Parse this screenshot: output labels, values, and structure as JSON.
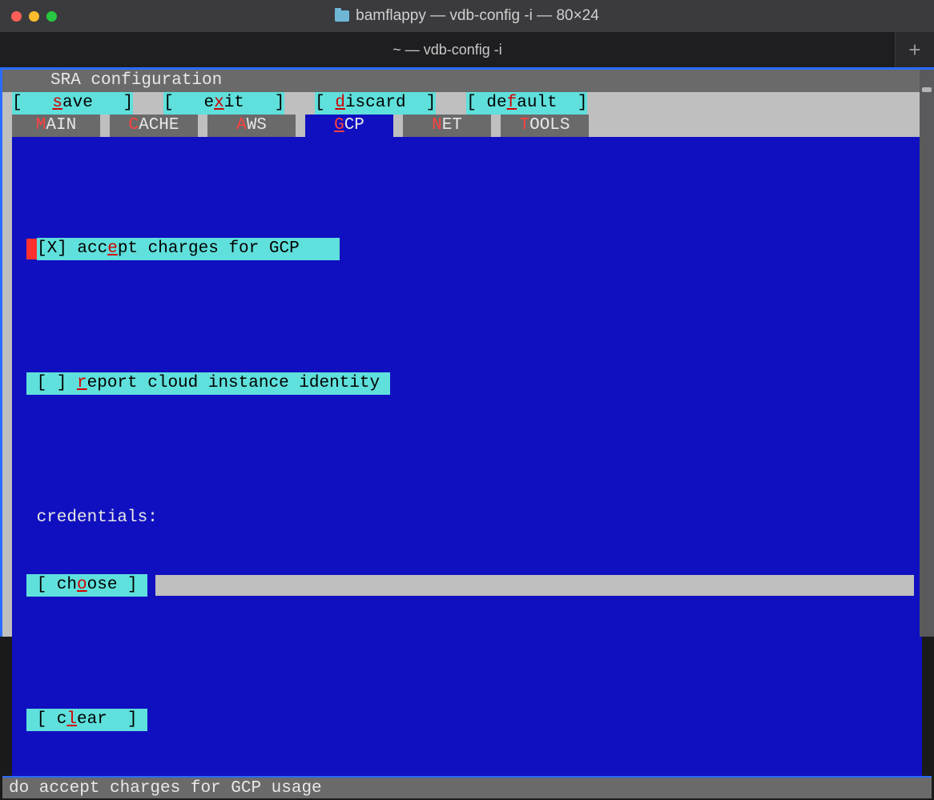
{
  "window": {
    "title": "bamflappy — vdb-config -i — 80×24",
    "tab_title": "~ — vdb-config -i"
  },
  "header": "SRA configuration",
  "buttons": {
    "save": {
      "pre": "[   ",
      "hk": "s",
      "rest": "ave   ]"
    },
    "exit": {
      "pre": "[   e",
      "hk": "x",
      "rest": "it   ]"
    },
    "discard": {
      "pre": "[ ",
      "hk": "d",
      "rest": "iscard  ]"
    },
    "default": {
      "pre": "[ de",
      "hk": "f",
      "rest": "ault  ]"
    }
  },
  "tabs": [
    {
      "hk": "M",
      "rest": "AIN",
      "active": false,
      "name": "tab-main"
    },
    {
      "hk": "C",
      "rest": "ACHE",
      "active": false,
      "name": "tab-cache"
    },
    {
      "hk": "A",
      "rest": "WS",
      "active": false,
      "name": "tab-aws"
    },
    {
      "hk": "G",
      "rest": "CP",
      "active": true,
      "name": "tab-gcp"
    },
    {
      "hk": "N",
      "rest": "ET",
      "active": false,
      "name": "tab-net"
    },
    {
      "hk": "T",
      "rest": "OOLS",
      "active": false,
      "name": "tab-tools"
    }
  ],
  "gcp": {
    "accept": {
      "prefix": "[X] acc",
      "hk": "e",
      "suffix": "pt charges for GCP    "
    },
    "report": {
      "prefix": " [ ] ",
      "hk": "r",
      "suffix": "eport cloud instance identity "
    },
    "cred_label": " credentials:",
    "choose": {
      "prefix": " [ ch",
      "hk": "o",
      "suffix": "ose ] "
    },
    "clear": {
      "prefix": " [ c",
      "hk": "l",
      "suffix": "ear  ] "
    }
  },
  "status": "do accept charges for GCP usage"
}
